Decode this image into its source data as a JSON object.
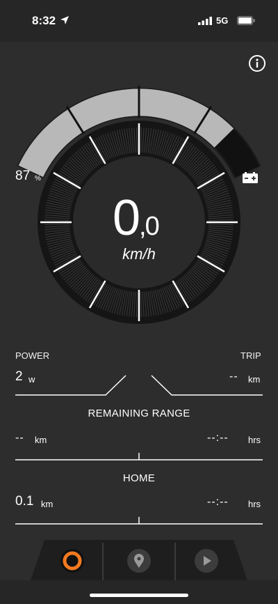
{
  "status_bar": {
    "time": "8:32",
    "network": "5G"
  },
  "gauge": {
    "assist_fraction": 0.85,
    "battery_percent_value": "87",
    "battery_percent_unit": "%",
    "speed_value": "0",
    "speed_decimal": ",0",
    "speed_unit": "km/h"
  },
  "stats": {
    "power": {
      "label": "POWER",
      "value": "2",
      "unit": "w"
    },
    "trip": {
      "label": "TRIP",
      "value": "--",
      "unit": "km"
    },
    "remaining_range": {
      "title": "REMAINING RANGE",
      "distance_value": "--",
      "distance_unit": "km",
      "time_value": "--:--",
      "time_unit": "hrs"
    },
    "home": {
      "title": "HOME",
      "distance_value": "0.1",
      "distance_unit": "km",
      "time_value": "--:--",
      "time_unit": "hrs"
    }
  },
  "tabs": [
    {
      "icon": "ring-icon",
      "active": true
    },
    {
      "icon": "map-pin-icon",
      "active": false
    },
    {
      "icon": "play-icon",
      "active": false
    }
  ],
  "colors": {
    "accent": "#f47a20",
    "background": "#2d2d2d"
  }
}
